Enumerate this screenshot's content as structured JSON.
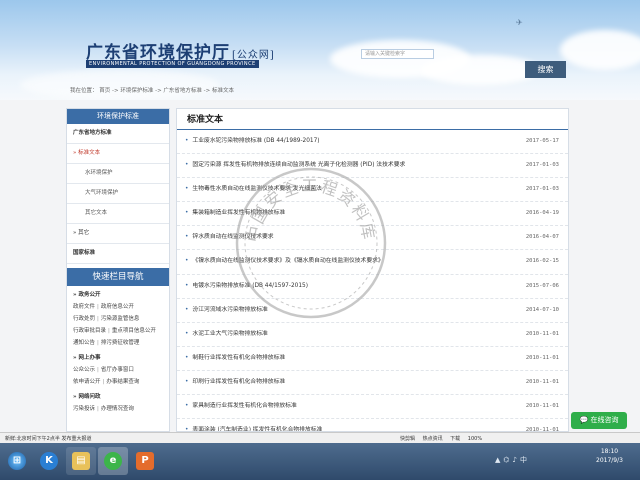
{
  "header": {
    "logo_title": "广东省环境保护厅",
    "logo_suffix": "[公众网]",
    "logo_en": "ENVIRONMENTAL PROTECTION OF GUANGDONG PROVINCE",
    "search_placeholder": "请输入关键检索字",
    "search_button": "搜索"
  },
  "breadcrumb": "我在位置：  首页 -> 环境保护标准 -> 广东省地方标准 -> 标准文本",
  "sidebar": {
    "header": "环境保护标准",
    "items": [
      {
        "label": "广东省地方标准"
      },
      {
        "label": "» 标准文本"
      },
      {
        "label": "水环境保护"
      },
      {
        "label": "大气环境保护"
      },
      {
        "label": "其它文本"
      },
      {
        "label": "» 其它"
      },
      {
        "label": "国家标准"
      }
    ],
    "quick_nav_header": "快速栏目导航",
    "quick_sections": [
      {
        "title": "» 政务公开",
        "rows": [
          [
            "政府文件",
            "政府信息公开"
          ],
          [
            "行政处罚",
            "污染源监管信息"
          ],
          [
            "行政审批目录",
            "重点项目信息公开"
          ],
          [
            "通知公告",
            "排污费征收管理"
          ]
        ]
      },
      {
        "title": "» 网上办事",
        "rows": [
          [
            "公众公示",
            "省厅办事窗口"
          ],
          [
            "依申请公开",
            "办事结果查询"
          ]
        ]
      },
      {
        "title": "» 网络问政",
        "rows": [
          [
            "污染投诉",
            "办理情况查询"
          ]
        ]
      }
    ]
  },
  "main": {
    "title": "标准文本",
    "rows": [
      {
        "title": "工业废水铊污染物排放标准 (DB 44/1989-2017)",
        "date": "2017-05-17"
      },
      {
        "title": "固定污染源  挥发性有机物排放连续自动监测系统  光离子化检测器 (PID) 法技术要求",
        "date": "2017-01-03"
      },
      {
        "title": "生物毒性水质自动在线监测仪技术要求  发光细菌法",
        "date": "2017-01-03"
      },
      {
        "title": "集装箱制造业挥发性有机物排放标准",
        "date": "2016-04-19"
      },
      {
        "title": "锌水质自动在线监测仪技术要求",
        "date": "2016-04-07"
      },
      {
        "title": "《镍水质自动在线监测仪技术要求》及《镉水质自动在线监测仪技术要求》",
        "date": "2016-02-15"
      },
      {
        "title": "电镀水污染物排放标准 (DB 44/1597-2015)",
        "date": "2015-07-06"
      },
      {
        "title": "汾江河流域水污染物排放标准",
        "date": "2014-07-10"
      },
      {
        "title": "水泥工业大气污染物排放标准",
        "date": "2010-11-01"
      },
      {
        "title": "制鞋行业挥发性有机化合物排放标准",
        "date": "2010-11-01"
      },
      {
        "title": "印刷行业挥发性有机化合物排放标准",
        "date": "2010-11-01"
      },
      {
        "title": "家具制造行业挥发性有机化合物排放标准",
        "date": "2010-11-01"
      },
      {
        "title": "表面涂装 (汽车制造业) 挥发性有机化合物排放标准",
        "date": "2010-11-01"
      }
    ]
  },
  "watermark": "中国安全工程资料库",
  "chat_button": "在线咨询",
  "statusbar": {
    "left": "新鲜:北京时间下午2点半 发布重大报道",
    "right": "快剪辑  热点资讯  下载  100%"
  },
  "taskbar": {
    "icons": [
      "start-orb",
      "k-app",
      "file-explorer",
      "browser",
      "presentation-app"
    ],
    "time": "18:10",
    "date": "2017/9/3"
  }
}
